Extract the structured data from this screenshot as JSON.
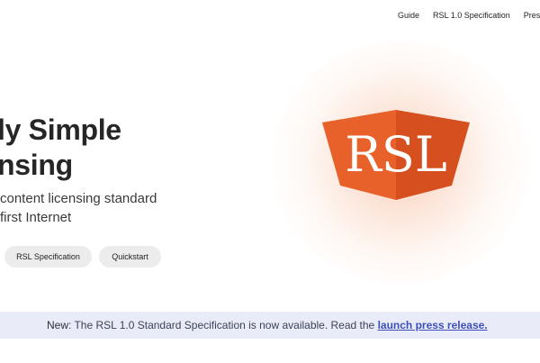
{
  "nav": {
    "items": [
      {
        "label": "Guide"
      },
      {
        "label": "RSL 1.0 Specification"
      },
      {
        "label": "Press"
      }
    ]
  },
  "logo": {
    "text": "RSL",
    "colors": {
      "left": "#e8612a",
      "right": "#d8501e",
      "text": "#ffffff"
    }
  },
  "hero": {
    "title_line1": "ly Simple",
    "title_line2": "nsing",
    "subtitle_line1": "content licensing standard",
    "subtitle_line2": "first Internet"
  },
  "buttons": {
    "spec_label": "RSL Specification",
    "quickstart_label": "Quickstart"
  },
  "banner": {
    "lead": "New",
    "text": ": The RSL 1.0 Standard Specification is now available. Read the ",
    "link_label": "launch press release."
  },
  "colors": {
    "banner_bg": "#e9ecf8",
    "link": "#3d4fb8",
    "button_bg": "#ececec"
  }
}
